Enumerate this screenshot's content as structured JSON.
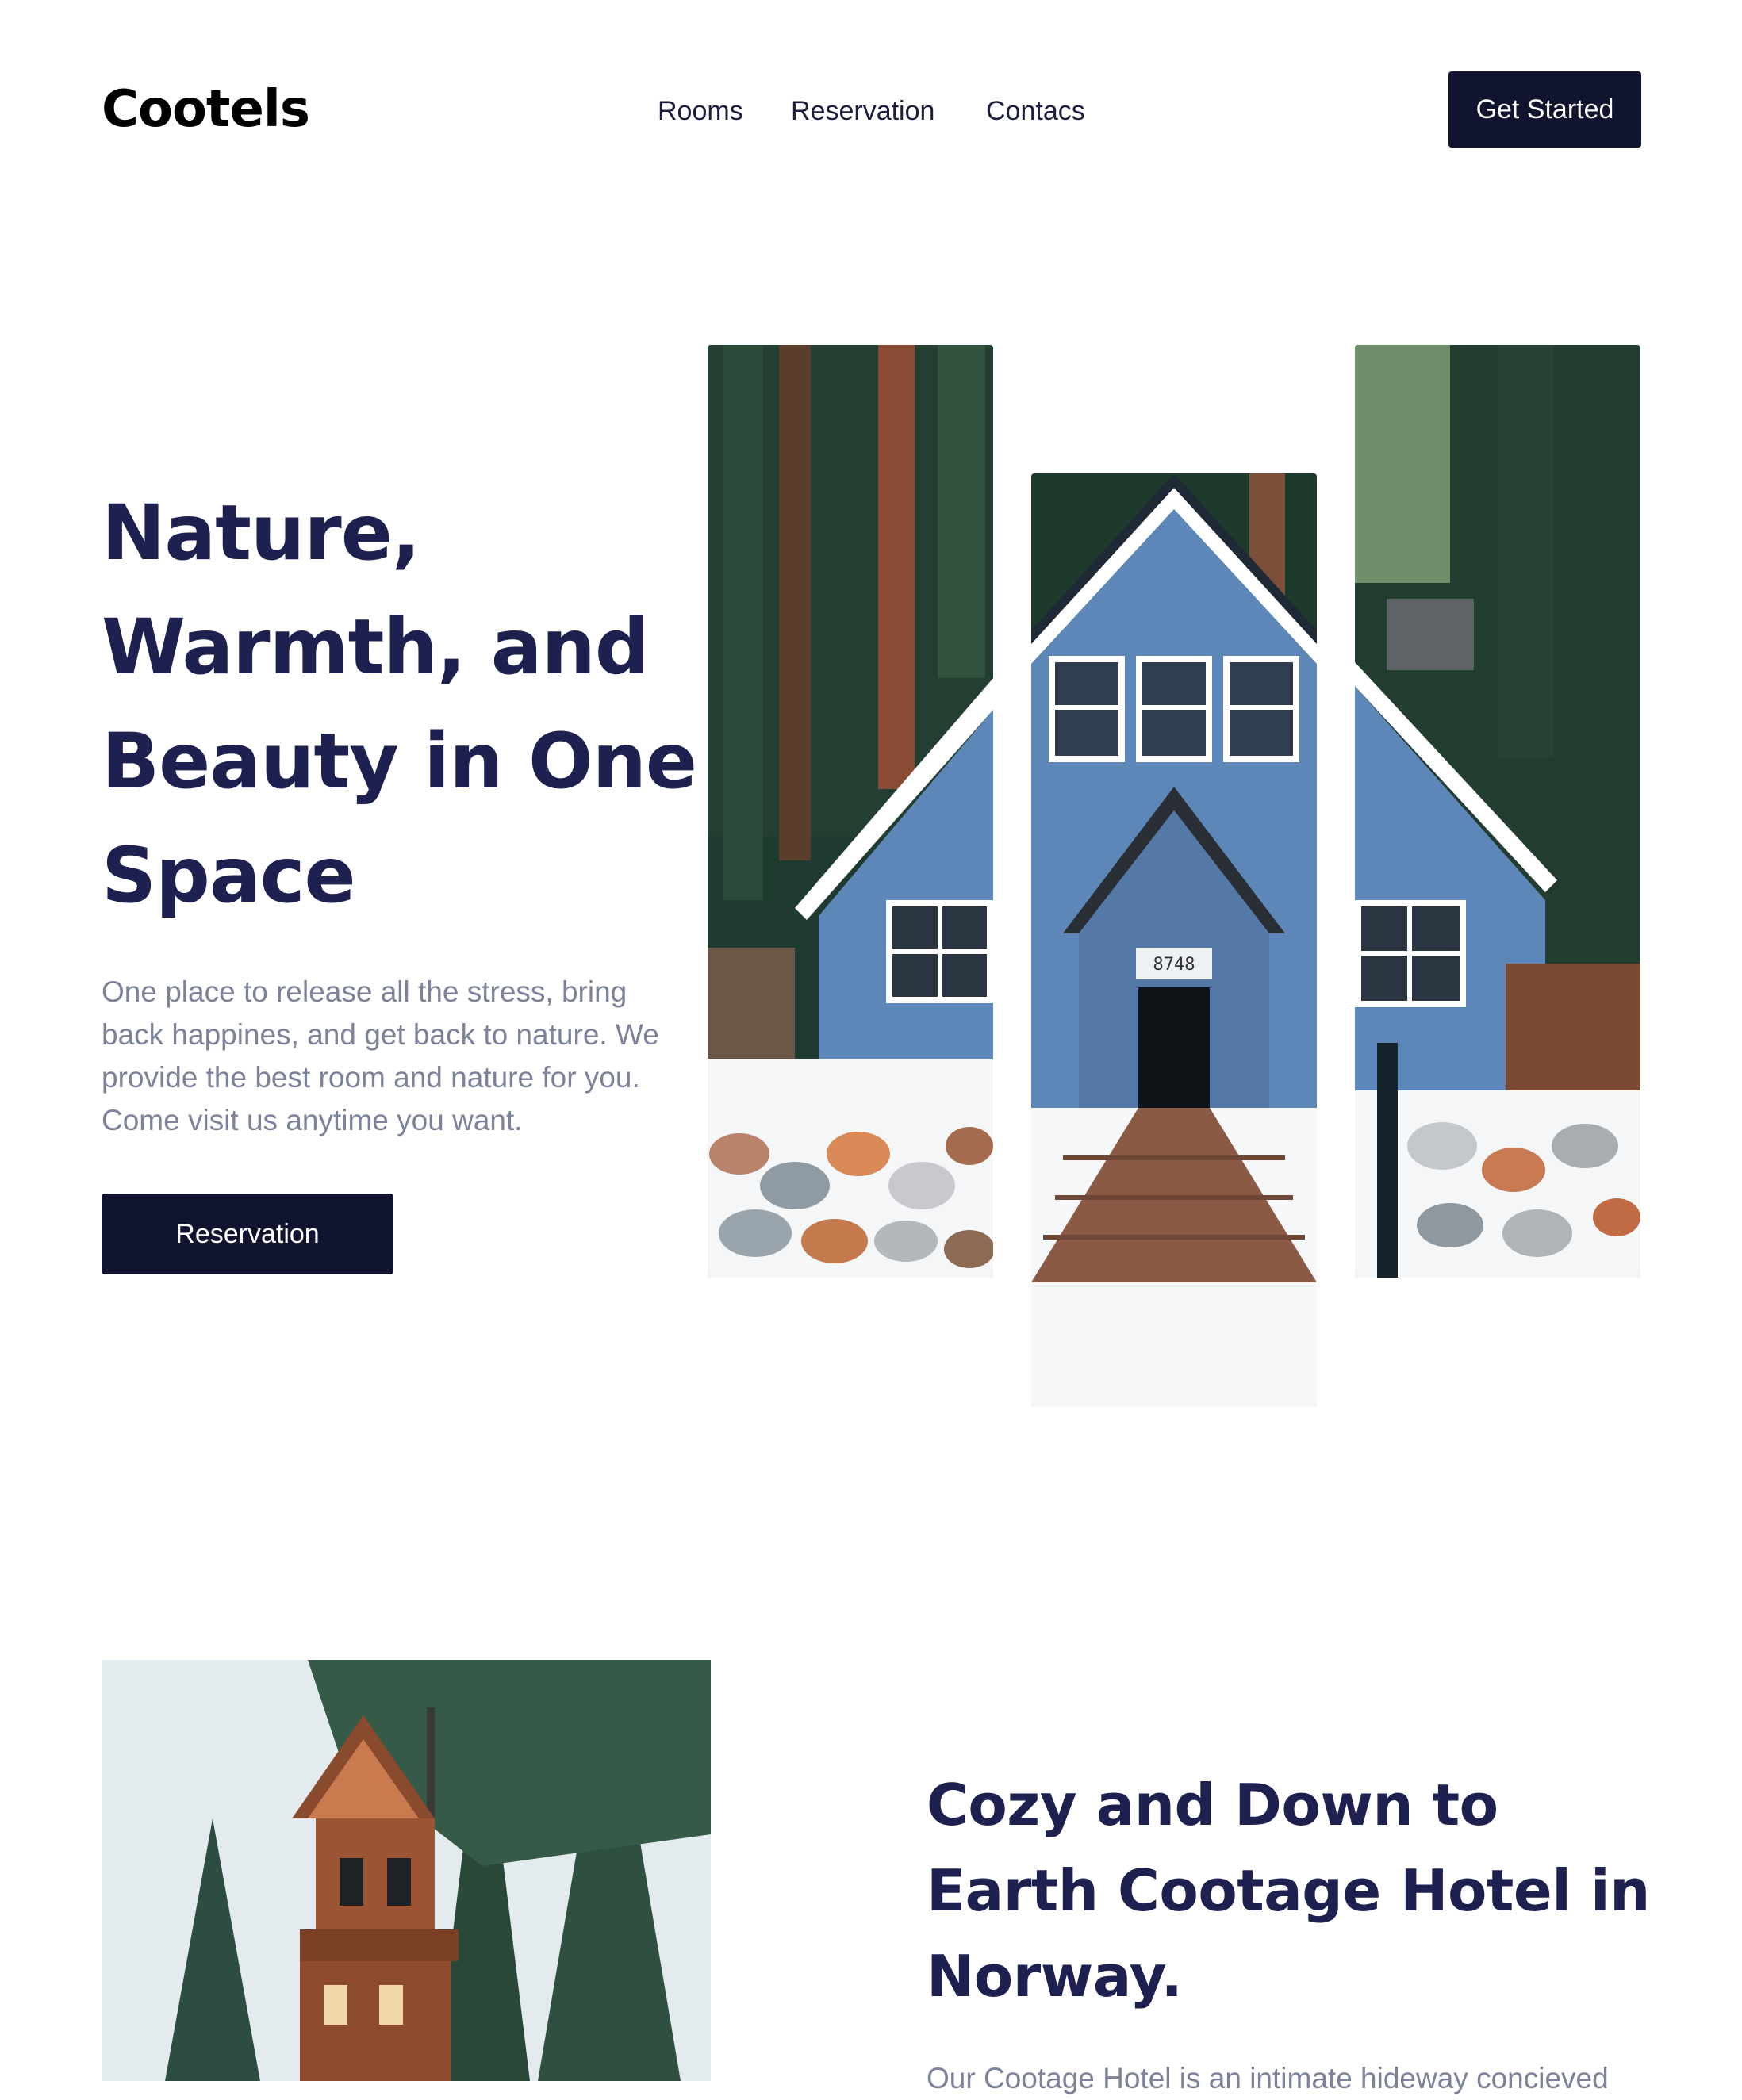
{
  "header": {
    "brand": "Cootels",
    "nav": [
      "Rooms",
      "Reservation",
      "Contacs"
    ],
    "cta": "Get Started"
  },
  "hero": {
    "title": "Nature, Warmth, and Beauty in One Space",
    "description": "One place to release all the stress, bring back happines, and get back to nature. We provide the best room and nature for you. Come visit us anytime you want.",
    "cta": "Reservation",
    "house_number": "8748",
    "images": [
      "cabin-left-strip",
      "cabin-center-strip",
      "cabin-right-strip"
    ]
  },
  "about": {
    "title": "Cozy and Down to Earth Cootage Hotel in Norway.",
    "description": "Our Cootage Hotel is an intimate hideway concieved",
    "image": "treehouse-photo"
  },
  "colors": {
    "primary": "#11142e",
    "heading": "#1e2150",
    "body_text": "#7b8299",
    "cabin_blue": "#5d87b8"
  }
}
